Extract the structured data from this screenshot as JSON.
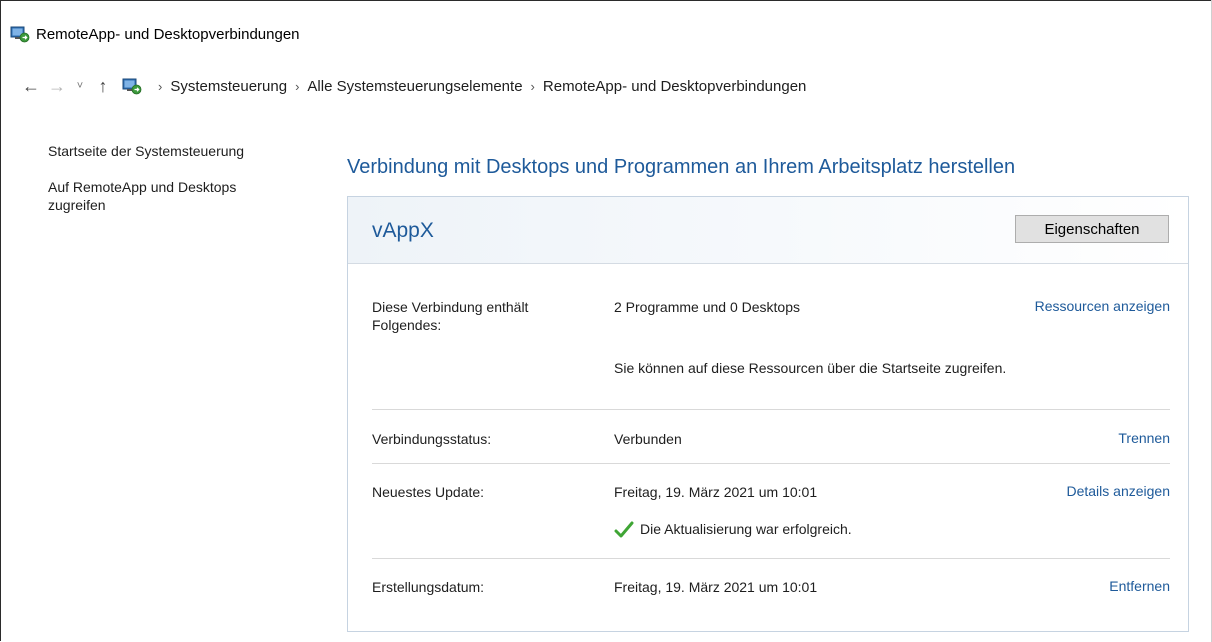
{
  "window": {
    "title": "RemoteApp- und Desktopverbindungen"
  },
  "address": {
    "crumbs": [
      "Systemsteuerung",
      "Alle Systemsteuerungselemente",
      "RemoteApp- und Desktopverbindungen"
    ]
  },
  "sidebar": {
    "items": [
      {
        "label": "Startseite der Systemsteuerung"
      },
      {
        "label": "Auf RemoteApp und Desktops zugreifen"
      }
    ]
  },
  "main": {
    "heading": "Verbindung mit Desktops und Programmen an Ihrem Arbeitsplatz herstellen",
    "connection": {
      "name": "vAppX",
      "properties_label": "Eigenschaften",
      "rows": [
        {
          "label": "Diese Verbindung enthält Folgendes:",
          "value": "2 Programme und 0 Desktops",
          "action": "Ressourcen anzeigen",
          "note": "Sie können auf diese Ressourcen über die Startseite zugreifen."
        },
        {
          "label": "Verbindungsstatus:",
          "value": "Verbunden",
          "action": "Trennen"
        },
        {
          "label": "Neuestes Update:",
          "value": "Freitag, 19. März 2021 um 10:01",
          "action": "Details anzeigen",
          "note": "Die Aktualisierung war erfolgreich."
        },
        {
          "label": "Erstellungsdatum:",
          "value": "Freitag, 19. März 2021 um 10:01",
          "action": "Entfernen"
        }
      ]
    }
  },
  "colors": {
    "link": "#1e5a9a",
    "heading": "#1e5a9a",
    "success": "#3fa535"
  },
  "icons": {
    "app": "remote-desktop-icon",
    "back": "back-arrow-icon",
    "forward": "forward-arrow-icon",
    "recent": "chevron-down-icon",
    "up": "up-arrow-icon",
    "success": "checkmark-icon"
  }
}
